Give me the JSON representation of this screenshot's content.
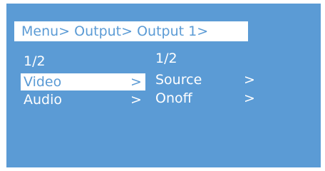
{
  "breadcrumb": "Menu> Output> Output 1>",
  "left_menu": {
    "page": "1/2",
    "items": [
      {
        "label": "Video",
        "arrow": ">"
      },
      {
        "label": "Audio",
        "arrow": ">"
      }
    ]
  },
  "right_menu": {
    "page": "1/2",
    "items": [
      {
        "label": "Source",
        "arrow": ">"
      },
      {
        "label": "Onoff",
        "arrow": ">"
      }
    ]
  },
  "colors": {
    "screen_bg": "#5b9bd5",
    "highlight_bg": "#ffffff",
    "text": "#ffffff"
  }
}
